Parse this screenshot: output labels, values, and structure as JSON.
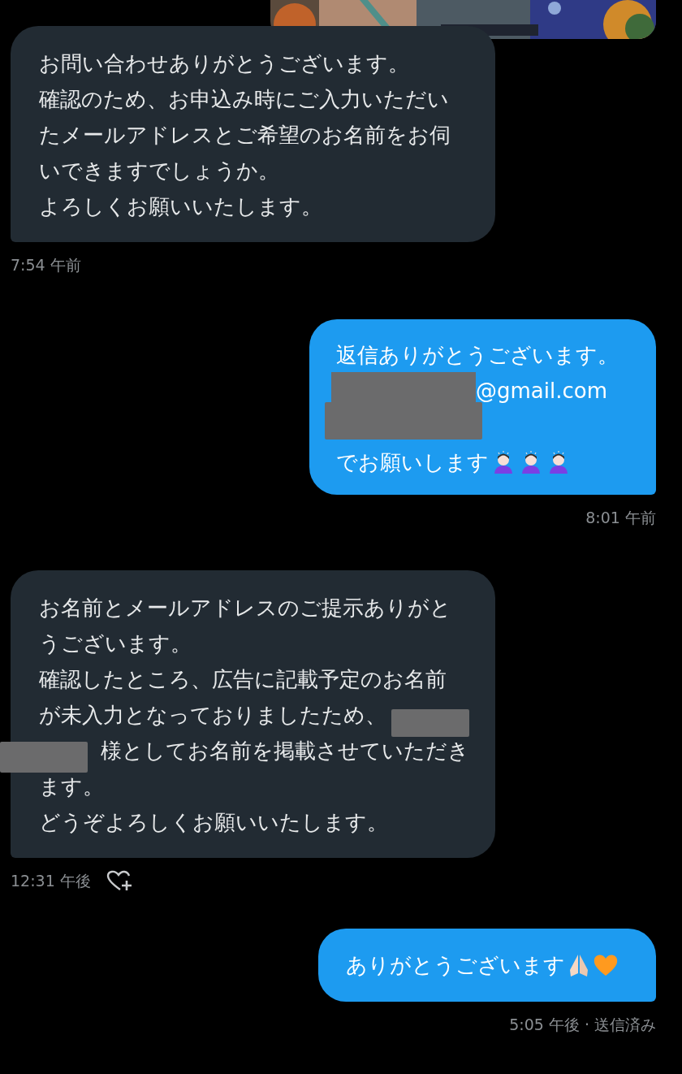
{
  "messages": [
    {
      "outgoing": false,
      "lines": [
        [
          {
            "kind": "text",
            "text": "お問い合わせありがとうございます。"
          }
        ],
        [
          {
            "kind": "text",
            "text": "確認のため、お申込み時にご入力いただい"
          }
        ],
        [
          {
            "kind": "text",
            "text": "たメールアドレスとご希望のお名前をお伺"
          }
        ],
        [
          {
            "kind": "text",
            "text": "いできますでしょうか。"
          }
        ],
        [
          {
            "kind": "text",
            "text": "よろしくお願いいたします。"
          }
        ]
      ],
      "time": "7:54 午前",
      "reaction_button": false
    },
    {
      "outgoing": true,
      "lines": [
        [
          {
            "kind": "text",
            "text": "返信ありがとうございます。"
          }
        ],
        [
          {
            "kind": "redaction"
          },
          {
            "kind": "text",
            "text": "@gmail.com"
          }
        ],
        [
          {
            "kind": "redaction_wide"
          }
        ],
        [
          {
            "kind": "text",
            "text": "でお願いします"
          },
          {
            "kind": "emoji_bow"
          },
          {
            "kind": "emoji_bow"
          },
          {
            "kind": "emoji_bow"
          }
        ]
      ],
      "time": "8:01 午前",
      "reaction_button": false
    },
    {
      "outgoing": false,
      "lines": [
        [
          {
            "kind": "text",
            "text": "お名前とメールアドレスのご提示ありがと"
          }
        ],
        [
          {
            "kind": "text",
            "text": "うございます。"
          }
        ],
        [
          {
            "kind": "text",
            "text": "確認したところ、広告に記載予定のお名前"
          }
        ],
        [
          {
            "kind": "text",
            "text": "が未入力となっておりましたため、"
          },
          {
            "kind": "redaction"
          }
        ],
        [
          {
            "kind": "redaction_outside"
          },
          {
            "kind": "text",
            "text": "様としてお名前を掲載させていただき"
          }
        ],
        [
          {
            "kind": "text",
            "text": "ます。"
          }
        ],
        [
          {
            "kind": "text",
            "text": "どうぞよろしくお願いいたします。"
          }
        ]
      ],
      "time": "12:31 午後",
      "reaction_button": true
    },
    {
      "outgoing": true,
      "lines": [
        [
          {
            "kind": "text",
            "text": "ありがとうございます"
          },
          {
            "kind": "emoji_pray"
          },
          {
            "kind": "emoji_heart"
          }
        ]
      ],
      "time": "5:05 午後 · 送信済み",
      "reaction_button": false
    }
  ]
}
